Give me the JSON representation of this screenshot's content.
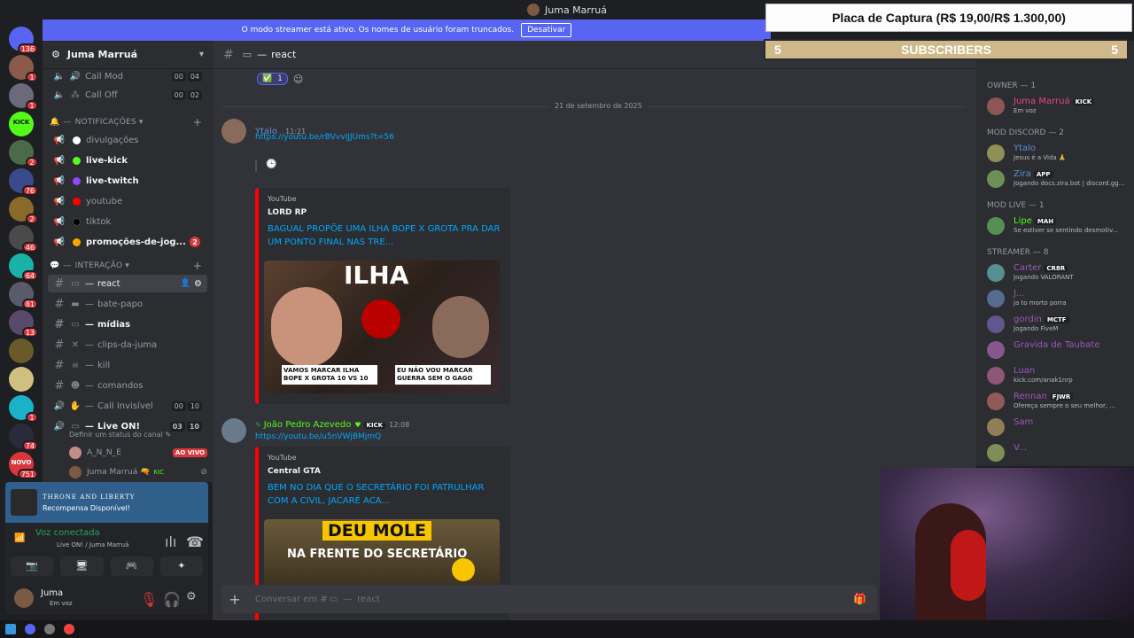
{
  "window": {
    "title": "Juma Marruá"
  },
  "servers": [
    {
      "name": "discord-home",
      "badge": "136",
      "color": "#5865f2"
    },
    {
      "name": "server-1",
      "badge": "1",
      "color": "#8a5a4a"
    },
    {
      "name": "server-2",
      "badge": "1",
      "color": "#6a6a7a"
    },
    {
      "name": "kick-server",
      "label": "KICK",
      "badge": "",
      "color": "#53fc18"
    },
    {
      "name": "server-4",
      "badge": "2",
      "color": "#4a6a4a"
    },
    {
      "name": "server-5",
      "badge": "76",
      "color": "#3a4a8a"
    },
    {
      "name": "server-6",
      "badge": "2",
      "color": "#8a6a2a"
    },
    {
      "name": "server-7",
      "badge": "46",
      "color": "#4a4a4a"
    },
    {
      "name": "server-8",
      "badge": "64",
      "color": "#1ab2a8"
    },
    {
      "name": "server-9",
      "badge": "81",
      "color": "#5a5a6a"
    },
    {
      "name": "server-10",
      "badge": "13",
      "color": "#5a4a6a"
    },
    {
      "name": "server-11",
      "badge": "",
      "color": "#6a5a2a"
    },
    {
      "name": "server-12",
      "badge": "",
      "color": "#d0c080"
    },
    {
      "name": "server-13",
      "badge": "1",
      "color": "#1ab2c8"
    },
    {
      "name": "server-14",
      "badge": "74",
      "color": "#2a2a3a"
    },
    {
      "name": "new-server",
      "label": "NOVO",
      "badge": "751",
      "color": "#da373c"
    }
  ],
  "streamer_bar": {
    "text": "O modo streamer está ativo. Os nomes de usuário foram truncados.",
    "button": "Desativar"
  },
  "guild": {
    "name": "Juma Marruá"
  },
  "channels_top": [
    {
      "name": "Call Mod",
      "counts": [
        "00",
        "04"
      ]
    },
    {
      "name": "Call Off",
      "counts": [
        "00",
        "02"
      ]
    }
  ],
  "categories": {
    "notifications": "NOTIFICAÇÕES",
    "interaction": "INTERAÇÃO"
  },
  "notif_channels": [
    {
      "name": "divulgações",
      "dot": "#ffffff",
      "unread": false
    },
    {
      "name": "live-kick",
      "dot": "#53fc18",
      "unread": true
    },
    {
      "name": "live-twitch",
      "dot": "#9146ff",
      "unread": true
    },
    {
      "name": "youtube",
      "dot": "#ff0000",
      "unread": false
    },
    {
      "name": "tiktok",
      "dot": "#000000",
      "unread": false
    },
    {
      "name": "promoções-de-jog...",
      "dot": "#ffa500",
      "unread": true,
      "badge": "2"
    }
  ],
  "interaction_channels": [
    {
      "name": "react",
      "active": true
    },
    {
      "name": "bate-papo",
      "unread": false
    },
    {
      "name": "mídias",
      "unread": true
    },
    {
      "name": "clips-da-juma",
      "unread": false
    },
    {
      "name": "kill",
      "unread": false
    },
    {
      "name": "comandos",
      "unread": false
    },
    {
      "name": "Call Invisível",
      "counts": [
        "00",
        "10"
      ]
    },
    {
      "name": "Live ON!",
      "counts": [
        "03",
        "10"
      ],
      "unread": true
    }
  ],
  "voice_channel": {
    "status_hint": "Definir um status do canal",
    "members": [
      {
        "name": "A_N_N_E",
        "badge": "AO VIVO"
      },
      {
        "name": "Juma Marruá",
        "tag": "KIC"
      }
    ]
  },
  "reward": {
    "game": "THRONE AND LIBERTY",
    "text": "Recompensa Disponível!"
  },
  "voice_status": {
    "title": "Voz conectada",
    "channel": "Live ON! / Juma Marruá"
  },
  "user": {
    "name": "Juma",
    "status": "Em voz"
  },
  "chat": {
    "channel": "react",
    "reactions": [
      {
        "emoji": "✅",
        "count": "1"
      }
    ],
    "date_divider": "21 de setembro de 2025",
    "messages": [
      {
        "author": "Ytalo",
        "time": "11:21",
        "link": "https://youtu.be/rBVvvIJJUms?t=56",
        "embed": {
          "provider": "YouTube",
          "author": "LORD RP",
          "title": "BAGUAL PROPÕE UMA ILHA BOPE X GROTA PRA DAR UM PONTO FINAL NAS TRE...",
          "thumb": {
            "headline": "ILHA",
            "caption_left": "VAMOS MARCAR ILHA BOPE X GROTA 10 VS 10",
            "caption_right": "EU NÃO VOU MARCAR GUERRA SEM O GAGO"
          }
        }
      },
      {
        "author": "João Pedro Azevedo",
        "tag": "KICK",
        "time": "12:08",
        "link": "https://youtu.be/u5nVWjBMjmQ",
        "embed": {
          "provider": "YouTube",
          "author": "Central GTA",
          "title": "BEM NO DIA QUE O SECRETÁRIO FOI PATRULHAR COM A CIVIL, JACARÉ ACA...",
          "thumb": {
            "headline": "DEU MOLE",
            "caption": "NA FRENTE DO SECRETÁRIO"
          }
        }
      }
    ],
    "composer_placeholder": "Conversar em #",
    "composer_channel": "react"
  },
  "members": {
    "groups": [
      {
        "title": "OWNER — 1",
        "members": [
          {
            "name": "Juma Marruá",
            "tag": "KICK",
            "status": "Em voz",
            "color": "#e8468a"
          }
        ]
      },
      {
        "title": "MOD DISCORD — 2",
        "members": [
          {
            "name": "Ytalo",
            "status": "Jesus é a Vida 🙏",
            "color": "#5b8fd6"
          },
          {
            "name": "Zira",
            "tag": "APP",
            "status": "Jogando docs.zira.bot | discord.gg...",
            "color": "#5b8fd6"
          }
        ]
      },
      {
        "title": "MOD LIVE — 1",
        "members": [
          {
            "name": "Lipe",
            "tag": "MAH",
            "status": "Se estiver se sentindo desmotiv...",
            "color": "#53fc18"
          }
        ]
      },
      {
        "title": "STREAMER — 8",
        "members": [
          {
            "name": "Carter",
            "tag": "CR8R",
            "status": "Jogando VALORANT",
            "color": "#9b59b6"
          },
          {
            "name": "J...",
            "status": "ja to morto porra",
            "color": "#9b59b6"
          },
          {
            "name": "gordin",
            "tag": "MCTF",
            "status": "Jogando FiveM",
            "color": "#9b59b6"
          },
          {
            "name": "Gravida de Taubate",
            "status": "",
            "color": "#9b59b6"
          },
          {
            "name": "Luan",
            "status": "kick.com/anak1nrp",
            "color": "#9b59b6"
          },
          {
            "name": "Rennan",
            "tag": "FJWR",
            "status": "Ofereça sempre o seu melhor, ...",
            "color": "#9b59b6"
          },
          {
            "name": "Sam",
            "status": "",
            "color": "#9b59b6"
          },
          {
            "name": "V...",
            "status": "",
            "color": "#9b59b6"
          }
        ]
      }
    ]
  },
  "overlay": {
    "capture": "Placa de Captura (R$ 19,00/R$ 1.300,00)",
    "subs_left": "5",
    "subs_label": "SUBSCRIBERS",
    "subs_right": "5"
  }
}
